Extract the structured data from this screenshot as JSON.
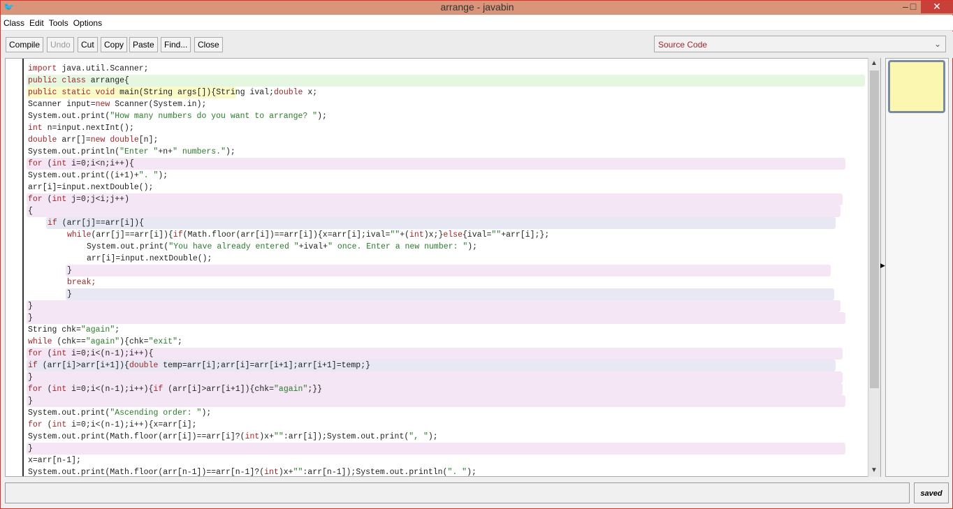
{
  "window": {
    "title": "arrange - javabin",
    "minimize": "–",
    "maximize": "□",
    "close": "✕"
  },
  "menu": [
    "Class",
    "Edit",
    "Tools",
    "Options"
  ],
  "toolbar": {
    "compile": "Compile",
    "undo": "Undo",
    "cut": "Cut",
    "copy": "Copy",
    "paste": "Paste",
    "find": "Find...",
    "close": "Close"
  },
  "view_select": {
    "selected": "Source Code"
  },
  "status": {
    "message": "",
    "saved": "saved"
  },
  "colors": {
    "keyword": "#a0262a",
    "string": "#2b7a2b",
    "class_scope": "#e5f7e1",
    "method_scope": "#fafac8",
    "loop_scope": "#f5e6f5",
    "if_scope": "#e8e8f5"
  },
  "code": [
    "import java.util.Scanner;",
    "public class arrange{",
    "public static void main(String args[]){String ival;double x;",
    "Scanner input=new Scanner(System.in);",
    "System.out.print(\"How many numbers do you want to arrange? \");",
    "int n=input.nextInt();",
    "double arr[]=new double[n];",
    "System.out.println(\"Enter \"+n+\" numbers.\");",
    "for (int i=0;i<n;i++){",
    "System.out.print((i+1)+\". \");",
    "arr[i]=input.nextDouble();",
    "for (int j=0;j<i;j++)",
    "{",
    "if (arr[j]==arr[i]){",
    "while(arr[j]==arr[i]){if(Math.floor(arr[i])==arr[i]){x=arr[i];ival=\"\"+(int)x;}else{ival=\"\"+arr[i];};",
    "System.out.print(\"You have already entered \"+ival+\" once. Enter a new number: \");",
    "arr[i]=input.nextDouble();",
    "}",
    "break;",
    "}",
    "}",
    "}",
    "String chk=\"again\";",
    "while (chk==\"again\"){chk=\"exit\";",
    "for (int i=0;i<(n-1);i++){",
    "if (arr[i]>arr[i+1]){double temp=arr[i];arr[i]=arr[i+1];arr[i+1]=temp;}",
    "}",
    "for (int i=0;i<(n-1);i++){if (arr[i]>arr[i+1]){chk=\"again\";}}",
    "}",
    "System.out.print(\"Ascending order: \");",
    "for (int i=0;i<(n-1);i++){x=arr[i];",
    "System.out.print(Math.floor(arr[i])==arr[i]?(int)x+\"\":arr[i]);System.out.print(\", \");",
    "}",
    "x=arr[n-1];",
    "System.out.print(Math.floor(arr[n-1])==arr[n-1]?(int)x+\"\":arr[n-1]);System.out.println(\". \");"
  ]
}
